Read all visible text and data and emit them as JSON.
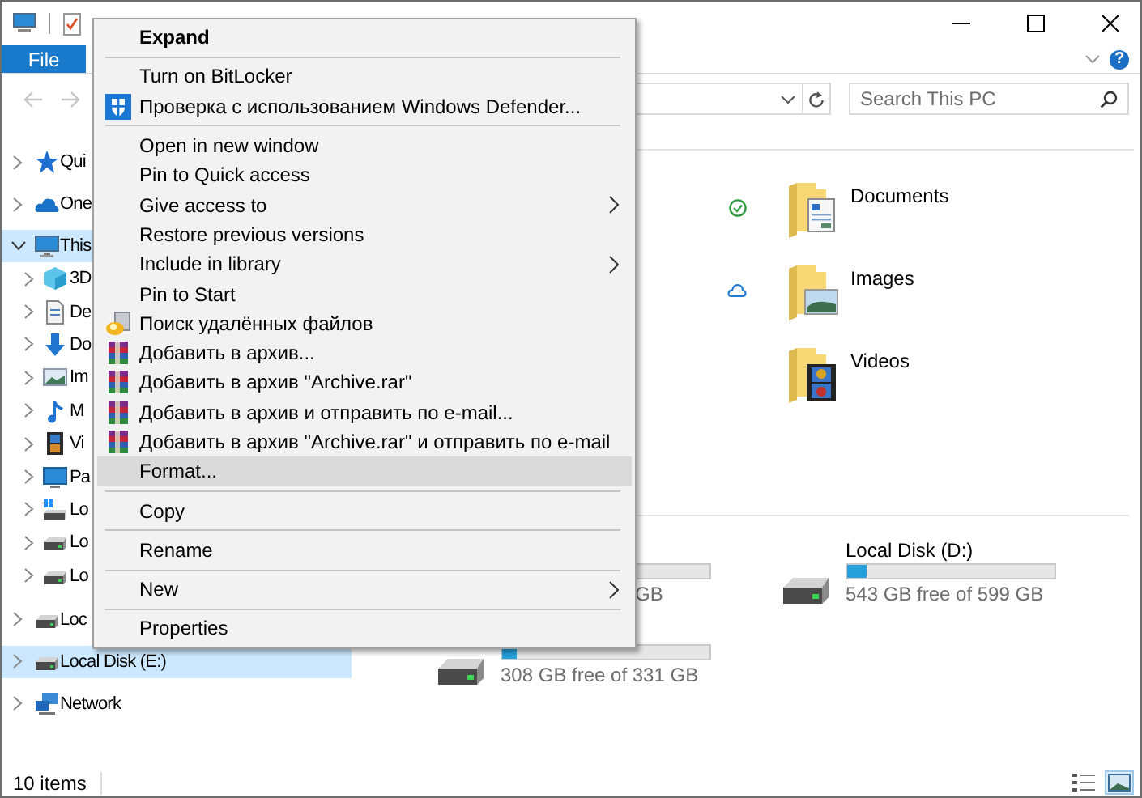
{
  "ribbon": {
    "file_tab": "File",
    "help": "?"
  },
  "navigation": {
    "back": {
      "disabled": true
    },
    "forward": {
      "disabled": true
    }
  },
  "search": {
    "placeholder": "Search This PC"
  },
  "sidebar": {
    "items": [
      {
        "kind": "star",
        "label": "Qui",
        "expanded": false,
        "selected": false
      },
      {
        "kind": "cloud",
        "label": "One",
        "expanded": false,
        "selected": false
      },
      {
        "kind": "pc",
        "label": "This",
        "expanded": true,
        "selected": true,
        "children": [
          {
            "kind": "cube",
            "label": "3D",
            "expanded": false,
            "selected": false
          },
          {
            "kind": "document",
            "label": "De",
            "expanded": false,
            "selected": false
          },
          {
            "kind": "download",
            "label": "Do",
            "expanded": false,
            "selected": false
          },
          {
            "kind": "image",
            "label": "Im",
            "expanded": false,
            "selected": false
          },
          {
            "kind": "music",
            "label": "M",
            "expanded": false,
            "selected": false
          },
          {
            "kind": "video",
            "label": "Vi",
            "expanded": false,
            "selected": false
          },
          {
            "kind": "desktop",
            "label": "Pa",
            "expanded": false,
            "selected": false
          },
          {
            "kind": "system-drive",
            "label": "Lo",
            "expanded": false,
            "selected": false
          },
          {
            "kind": "drive",
            "label": "Lo",
            "expanded": false,
            "selected": false
          },
          {
            "kind": "drive",
            "label": "Lo",
            "expanded": false,
            "selected": false
          }
        ]
      },
      {
        "kind": "drive",
        "label": "Loc",
        "expanded": false,
        "selected": false
      },
      {
        "kind": "drive",
        "label": "Local Disk (E:)",
        "expanded": false,
        "selected": true
      },
      {
        "kind": "network",
        "label": "Network",
        "expanded": false,
        "selected": false
      }
    ]
  },
  "content": {
    "folder_rows": [
      {
        "synced": true,
        "cloud_only": false,
        "kind": "documents",
        "name": "Documents"
      },
      {
        "synced": false,
        "cloud_only": true,
        "kind": "images",
        "name": "Images"
      },
      {
        "synced": false,
        "cloud_only": false,
        "kind": "videos",
        "name": "Videos"
      }
    ],
    "drives": [
      {
        "kind": "partial",
        "usage": "GB"
      },
      {
        "kind": "full",
        "name": "Local Disk (D:)",
        "level": 0.09,
        "usage": "543 GB free of 599 GB"
      },
      {
        "kind": "unlabeled",
        "level": 0.07,
        "usage": "308 GB free of 331 GB"
      }
    ]
  },
  "context_menu": {
    "items": [
      {
        "kind": "plain",
        "label": "Expand",
        "default": true,
        "submenu": false,
        "selected": false
      },
      {
        "kind": "separator"
      },
      {
        "kind": "plain",
        "label": "Turn on BitLocker",
        "default": false,
        "submenu": false,
        "selected": false
      },
      {
        "kind": "defender",
        "label": "Проверка с использованием Windows Defender...",
        "default": false,
        "submenu": false,
        "selected": false
      },
      {
        "kind": "separator"
      },
      {
        "kind": "plain",
        "label": "Open in new window",
        "default": false,
        "submenu": false,
        "selected": false
      },
      {
        "kind": "plain",
        "label": "Pin to Quick access",
        "default": false,
        "submenu": false,
        "selected": false
      },
      {
        "kind": "plain",
        "label": "Give access to",
        "default": false,
        "submenu": true,
        "selected": false
      },
      {
        "kind": "plain",
        "label": "Restore previous versions",
        "default": false,
        "submenu": false,
        "selected": false
      },
      {
        "kind": "plain",
        "label": "Include in library",
        "default": false,
        "submenu": true,
        "selected": false
      },
      {
        "kind": "plain",
        "label": "Pin to Start",
        "default": false,
        "submenu": false,
        "selected": false
      },
      {
        "kind": "recovery",
        "label": "Поиск удалённых файлов",
        "default": false,
        "submenu": false,
        "selected": false
      },
      {
        "kind": "winrar",
        "label": "Добавить в архив...",
        "default": false,
        "submenu": false,
        "selected": false
      },
      {
        "kind": "winrar",
        "label": "Добавить в архив \"Archive.rar\"",
        "default": false,
        "submenu": false,
        "selected": false
      },
      {
        "kind": "winrar",
        "label": "Добавить в архив и отправить по e-mail...",
        "default": false,
        "submenu": false,
        "selected": false
      },
      {
        "kind": "winrar",
        "label": "Добавить в архив \"Archive.rar\" и отправить по e-mail",
        "default": false,
        "submenu": false,
        "selected": false
      },
      {
        "kind": "plain",
        "label": "Format...",
        "default": false,
        "submenu": false,
        "selected": true
      },
      {
        "kind": "separator"
      },
      {
        "kind": "plain",
        "label": "Copy",
        "default": false,
        "submenu": false,
        "selected": false
      },
      {
        "kind": "separator"
      },
      {
        "kind": "plain",
        "label": "Rename",
        "default": false,
        "submenu": false,
        "selected": false
      },
      {
        "kind": "separator"
      },
      {
        "kind": "plain",
        "label": "New",
        "default": false,
        "submenu": true,
        "selected": false
      },
      {
        "kind": "separator"
      },
      {
        "kind": "plain",
        "label": "Properties",
        "default": false,
        "submenu": false,
        "selected": false
      }
    ]
  },
  "status_bar": {
    "item_count": "10 items",
    "views": [
      {
        "kind": "details",
        "selected": false
      },
      {
        "kind": "tiles",
        "selected": true
      }
    ]
  }
}
